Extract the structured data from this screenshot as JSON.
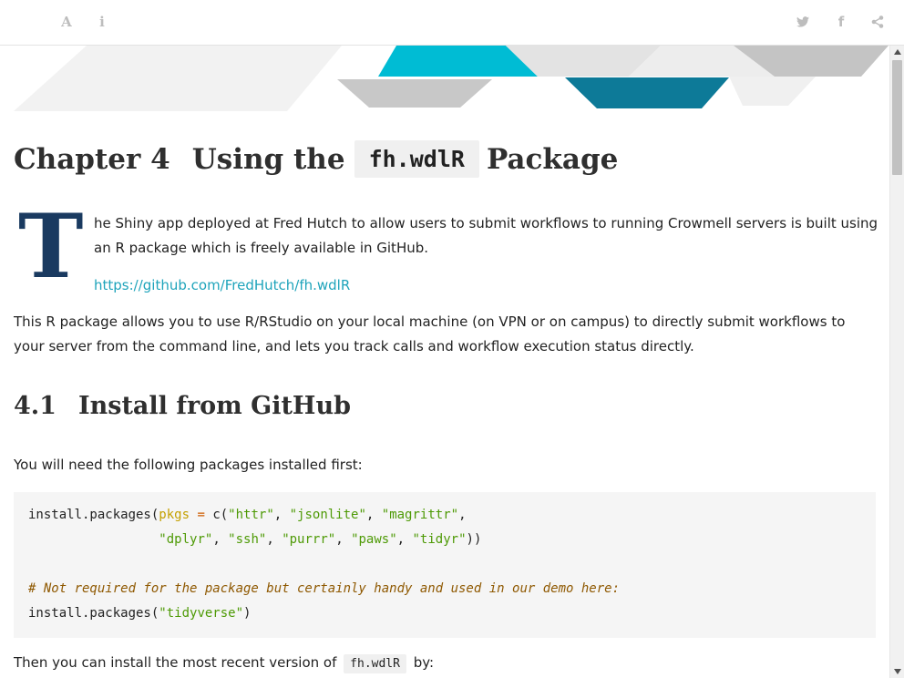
{
  "toolbar": {
    "left_icons": [
      "font-settings-icon",
      "info-icon"
    ],
    "right_icons": [
      "twitter-icon",
      "facebook-icon",
      "share-icon"
    ],
    "font_glyph": "A",
    "info_glyph": "i",
    "facebook_glyph": "f"
  },
  "chapter": {
    "number": "Chapter 4",
    "title_before": "Using the",
    "title_code": "fh.wdlR",
    "title_after": "Package"
  },
  "intro": {
    "dropcap": "T",
    "text": "he Shiny app deployed at Fred Hutch to allow users to submit workflows to running Crowmell servers is built using an R package which is freely available in GitHub.",
    "link": "https://github.com/FredHutch/fh.wdlR"
  },
  "paragraph2": "This R package allows you to use R/RStudio on your local machine (on VPN or on campus) to directly submit workflows to your server from the command line, and lets you track calls and workflow execution status directly.",
  "section": {
    "number": "4.1",
    "title": "Install from GitHub"
  },
  "paragraph3": "You will need the following packages installed first:",
  "code": {
    "l1_fn": "install.packages(",
    "l1_arg": "pkgs",
    "l1_eq": " = ",
    "l1_c": "c(",
    "l1_s1": "\"httr\"",
    "l1_s2": "\"jsonlite\"",
    "l1_s3": "\"magrittr\"",
    "l2_indent": "                 ",
    "l2_s1": "\"dplyr\"",
    "l2_s2": "\"ssh\"",
    "l2_s3": "\"purrr\"",
    "l2_s4": "\"paws\"",
    "l2_s5": "\"tidyr\"",
    "l2_end": "))",
    "comment": "# Not required for the package but certainly handy and used in our demo here:",
    "l5_fn": "install.packages(",
    "l5_s": "\"tidyverse\"",
    "l5_end": ")"
  },
  "paragraph4": {
    "before": "Then you can install the most recent version of",
    "code": "fh.wdlR",
    "after": "by:"
  },
  "colors": {
    "banner_teal": "#00bcd4",
    "banner_dark_teal": "#0d7a98",
    "dropcap": "#1a3a60",
    "link": "#1fa4bb"
  }
}
